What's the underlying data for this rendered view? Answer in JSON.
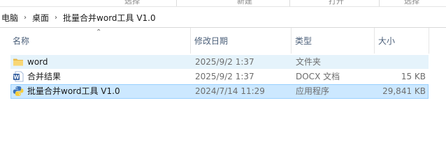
{
  "ribbon": {
    "labels": [
      "选择",
      "新建",
      "打开",
      "选择"
    ]
  },
  "breadcrumb": {
    "items": [
      "电脑",
      "桌面",
      "批量合并word工具 V1.0"
    ]
  },
  "columns": {
    "name": "名称",
    "modified": "修改日期",
    "type": "类型",
    "size": "大小"
  },
  "files": [
    {
      "name": "word",
      "modified": "2025/9/2 1:37",
      "type": "文件夹",
      "size": "",
      "icon": "folder-icon",
      "state": "hover"
    },
    {
      "name": "合并结果",
      "modified": "2025/9/2 1:37",
      "type": "DOCX 文档",
      "size": "15 KB",
      "icon": "word-document-icon",
      "state": "normal"
    },
    {
      "name": "批量合并word工具 V1.0",
      "modified": "2024/7/14 11:29",
      "type": "应用程序",
      "size": "29,841 KB",
      "icon": "python-app-icon",
      "state": "selected"
    }
  ],
  "colors": {
    "hover": "#e5f3fb",
    "selected": "#cce8ff",
    "selected_border": "#99d1ff",
    "header_text": "#4c607a",
    "folder": "#f8d775",
    "word_blue": "#2b579a"
  }
}
